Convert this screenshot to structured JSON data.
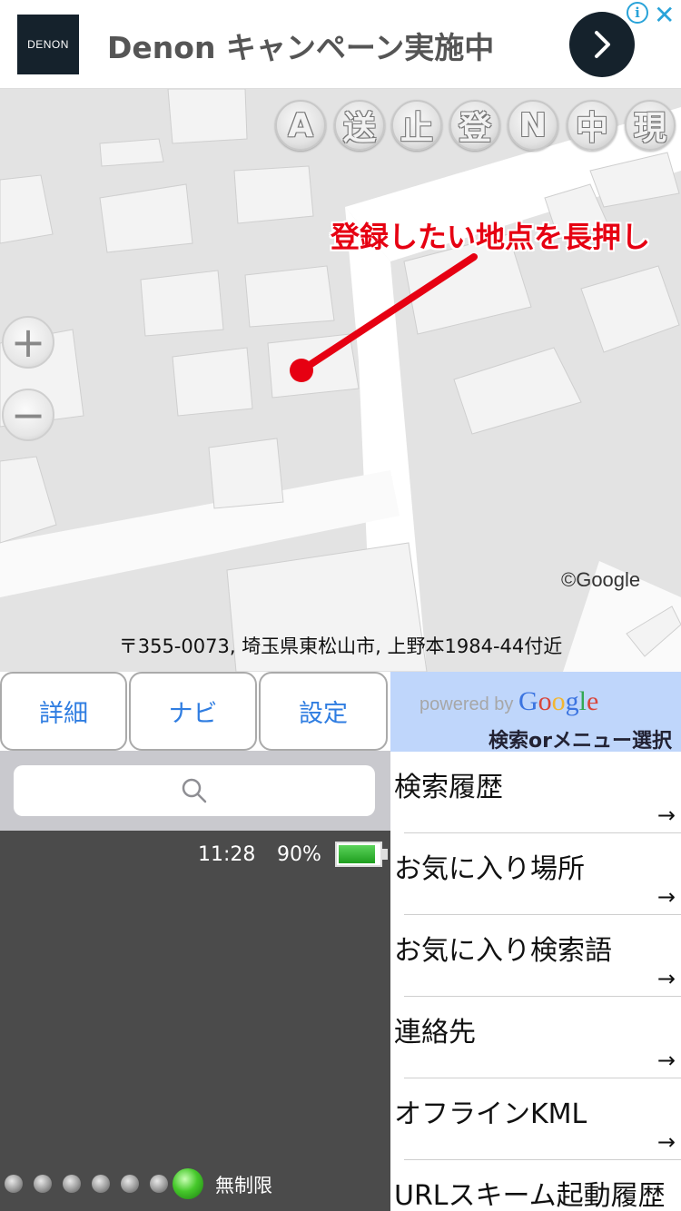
{
  "ad": {
    "logo": "DENON",
    "text": "Denon キャンペーン実施中",
    "info_icon": "info-icon",
    "close_label": "✕"
  },
  "map": {
    "toolbar": [
      "A",
      "送",
      "止",
      "登",
      "N",
      "中",
      "現"
    ],
    "zoom_in_label": "+",
    "zoom_out_label": "−",
    "annotation": "登録したい地点を長押し",
    "copyright": "©Google",
    "address": "〒355-0073, 埼玉県東松山市, 上野本1984-44付近"
  },
  "buttons": {
    "detail": "詳細",
    "navi": "ナビ",
    "settings": "設定"
  },
  "google_panel": {
    "powered_by": "powered by",
    "google": "Google",
    "title": "検索orメニュー選択"
  },
  "status": {
    "time": "11:28",
    "battery": "90%",
    "battery_level": 0.9,
    "unlimited": "無制限"
  },
  "menu": {
    "items": [
      {
        "label": "検索履歴",
        "arrow": "→"
      },
      {
        "label": "お気に入り場所",
        "arrow": "→"
      },
      {
        "label": "お気に入り検索語",
        "arrow": "→"
      },
      {
        "label": "連絡先",
        "arrow": "→"
      },
      {
        "label": "オフラインKML",
        "arrow": "→"
      },
      {
        "label": "URLスキーム起動履歴",
        "arrow": "→"
      }
    ]
  },
  "colors": {
    "accent": "#2f7de1",
    "annotation": "#e60012",
    "panel": "#bfd6fb",
    "dark": "#4b4b4b"
  }
}
